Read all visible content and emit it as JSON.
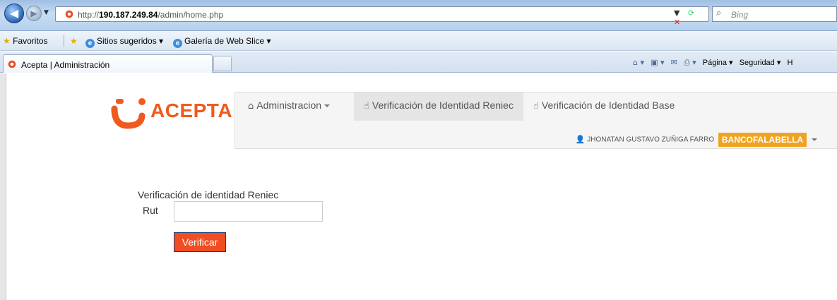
{
  "browser": {
    "url_prefix": "http://",
    "url_host": "190.187.249.84",
    "url_path": "/admin/home.php",
    "search_engine": "Bing",
    "favorites_label": "Favoritos",
    "fav_links": [
      {
        "label": "Sitios sugeridos ▾"
      },
      {
        "label": "Galería de Web Slice ▾"
      }
    ],
    "tab_title": "Acepta | Administración",
    "commands": [
      "Página ▾",
      "Seguridad ▾",
      "H"
    ]
  },
  "brand": {
    "name": "ACEPTA",
    "color": "#ef5a1e"
  },
  "nav": {
    "items": [
      {
        "label": "Administracion",
        "icon": "home-icon",
        "dropdown": true
      },
      {
        "label": "Verificación de Identidad Reniec",
        "icon": "hand-pointer-icon",
        "active": true
      },
      {
        "label": "Verificación de Identidad Base",
        "icon": "hand-pointer-icon"
      }
    ],
    "user_name": "JHONATAN GUSTAVO ZUÑIGA FARRO",
    "company_badge": "BANCOFALABELLA",
    "badge_color": "#f0a320"
  },
  "form": {
    "heading": "Verificación de identidad Reniec",
    "rut_label": "Rut",
    "rut_value": "",
    "submit_label": "Verificar",
    "button_color": "#f04e22"
  }
}
